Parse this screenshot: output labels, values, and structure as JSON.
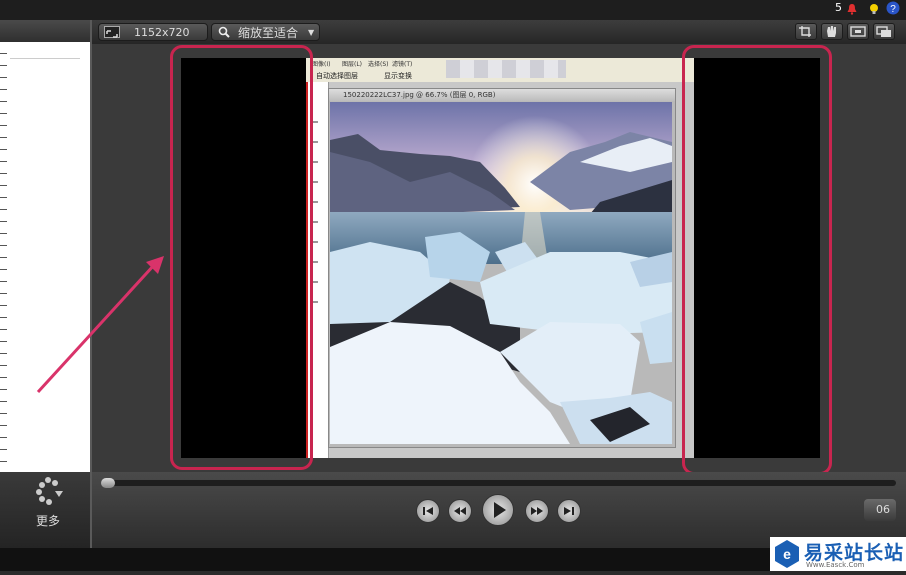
{
  "topbar": {
    "notification_count": "5"
  },
  "toolbar": {
    "resolution_label": "1152x720",
    "zoom_label": "缩放至适合"
  },
  "left_panel": {
    "more_label": "更多"
  },
  "preview": {
    "ps_title": "150220222LC37.jpg @ 66.7% (图层 0, RGB)",
    "menu_items": [
      "图像(I)",
      "图层(L)",
      "选择(S)",
      "滤镜(T)"
    ],
    "checkbox_a": "自动选择图层",
    "checkbox_b": "显示变换"
  },
  "transport": {
    "time_badge": "06"
  },
  "watermark": {
    "title": "易采站长站",
    "subtitle": "Www.Easck.Com"
  },
  "colors": {
    "highlight": "#c8254f",
    "arrow": "#d9336a",
    "logo_blue": "#1a5fb4"
  }
}
